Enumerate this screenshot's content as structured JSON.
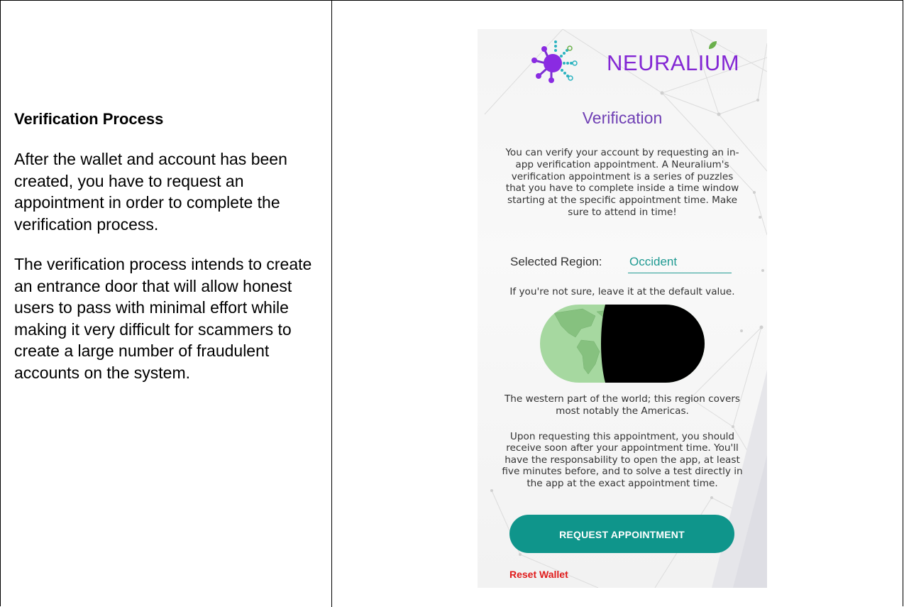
{
  "left_panel": {
    "heading": "Verification Process",
    "paragraph_1": "After the wallet and account has been created, you have to request an appointment in order to complete the verification process.",
    "paragraph_2": "The verification process intends to create an entrance door that will allow honest users to pass with minimal effort while making it very difficult for scammers to create a large number of fraudulent accounts on the system."
  },
  "app": {
    "logo_text": "NEURALIUM",
    "title": "Verification",
    "description": "You can verify your account by requesting an in-app verification appointment. A Neuralium's verification appointment is a series of puzzles that you have to complete inside a time window starting at the specific appointment time. Make sure to attend in time!",
    "region_label": "Selected Region:",
    "region_value": "Occident",
    "hint": "If you're not sure, leave it at the default value.",
    "globe_caption": "The western part of the world; this region covers most notably the Americas.",
    "info": "Upon requesting this appointment, you should receive soon after your appointment time. You'll have the responsability to open the app, at least five minutes before, and to solve a test directly in the app at the exact appointment time.",
    "request_button": "REQUEST APPOINTMENT",
    "reset_link": "Reset Wallet"
  },
  "colors": {
    "brand_purple": "#8327d4",
    "title_purple": "#6f3fb4",
    "teal": "#0f958b",
    "reset_red": "#e01b1b",
    "map_green": "#9fd39a"
  }
}
